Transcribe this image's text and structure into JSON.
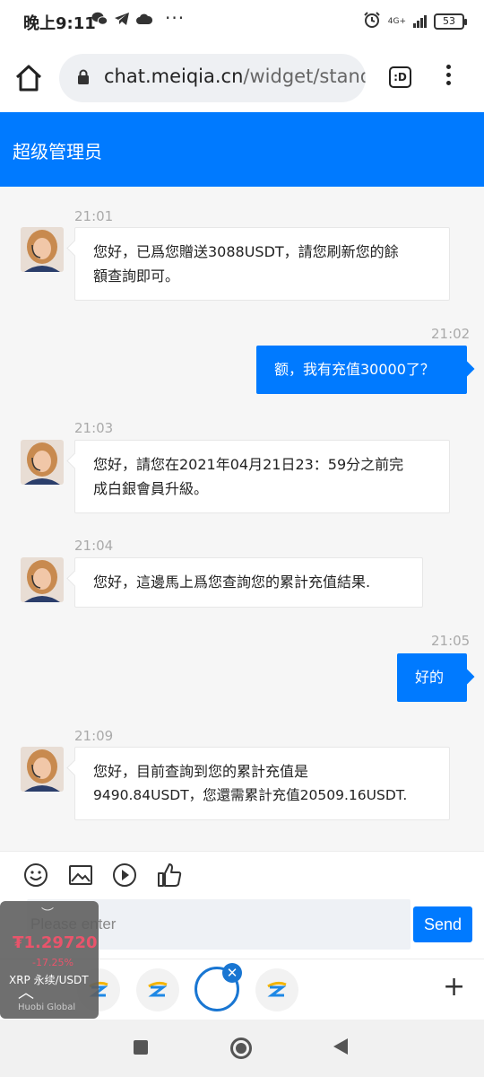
{
  "status_bar": {
    "time": "晚上9:11",
    "icons": [
      "wechat-icon",
      "telegram-icon",
      "cloud-icon",
      "more-dots-icon"
    ],
    "network": "4G+",
    "battery": "53"
  },
  "browser": {
    "url_domain": "chat.meiqia.cn",
    "url_path": "/widget/stand",
    "tabs_label": ":D"
  },
  "header": {
    "title": "超级管理员"
  },
  "messages": [
    {
      "direction": "in",
      "time": "21:01",
      "lines": [
        "您好，已爲您贈送3088USDT，請您刷新您的餘",
        "額查詢即可。"
      ]
    },
    {
      "direction": "out",
      "time": "21:02",
      "lines": [
        "额，我有充值30000了？"
      ]
    },
    {
      "direction": "in",
      "time": "21:03",
      "lines": [
        "您好，請您在2021年04月21日23：59分之前完",
        "成白銀會員升級。"
      ]
    },
    {
      "direction": "in",
      "time": "21:04",
      "lines": [
        "您好，這邊馬上爲您查詢您的累計充值結果."
      ]
    },
    {
      "direction": "out",
      "time": "21:05",
      "lines": [
        "好的"
      ]
    },
    {
      "direction": "in",
      "time": "21:09",
      "lines": [
        "您好，目前查詢到您的累計充值是",
        "9490.84USDT，您還需累計充值20509.16USDT."
      ]
    }
  ],
  "composer": {
    "placeholder": "Please enter",
    "send_label": "Send"
  },
  "widget": {
    "price": "₮1.29720",
    "change": "-17.25%",
    "pair": "XRP 永续/USDT",
    "brand": "Huobi Global"
  },
  "colors": {
    "accent": "#007aff",
    "negative": "#e9546b"
  }
}
